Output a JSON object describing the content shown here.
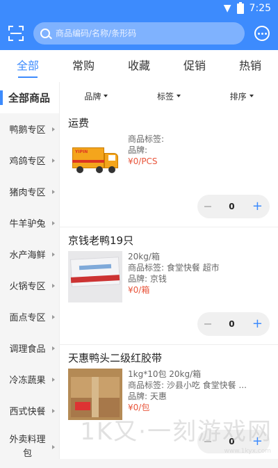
{
  "status_bar": {
    "time": "7:25"
  },
  "search": {
    "placeholder": "商品编码/名称/条形码"
  },
  "tabs": [
    {
      "label": "全部",
      "active": true
    },
    {
      "label": "常购"
    },
    {
      "label": "收藏"
    },
    {
      "label": "促销"
    },
    {
      "label": "热销"
    }
  ],
  "sidebar": {
    "items": [
      {
        "label": "全部商品",
        "active": true
      },
      {
        "label": "鸭鹅专区"
      },
      {
        "label": "鸡鸽专区"
      },
      {
        "label": "猪肉专区"
      },
      {
        "label": "牛羊驴兔"
      },
      {
        "label": "水产海鲜"
      },
      {
        "label": "火锅专区"
      },
      {
        "label": "面点专区"
      },
      {
        "label": "调理食品"
      },
      {
        "label": "冷冻蔬果"
      },
      {
        "label": "西式快餐"
      },
      {
        "label": "外卖料理包"
      }
    ]
  },
  "filters": {
    "brand": "品牌",
    "tag": "标签",
    "sort": "排序"
  },
  "products": [
    {
      "name": "运费",
      "spec": "",
      "tags": "商品标签:",
      "brand": "品牌:",
      "price": "¥0/PCS",
      "qty": "0",
      "thumb_text": "YIPIN"
    },
    {
      "name": "京钱老鸭19只",
      "spec": "20kg/箱",
      "tags": "商品标签:  食堂快餐 超市",
      "brand": "品牌:  京钱",
      "price": "¥0/箱",
      "qty": "0"
    },
    {
      "name": "天惠鸭头二级红胶带",
      "spec": "1kg*10包 20kg/箱",
      "tags": "商品标签:  沙县小吃 食堂快餐 ...",
      "brand": "品牌:  天惠",
      "price": "¥0/包",
      "qty": "0"
    }
  ],
  "watermark": {
    "text": "1K又·一刻游戏网",
    "url": "www.1kyx.com"
  },
  "colors": {
    "primary": "#3d8bfd",
    "price": "#e8543a"
  }
}
